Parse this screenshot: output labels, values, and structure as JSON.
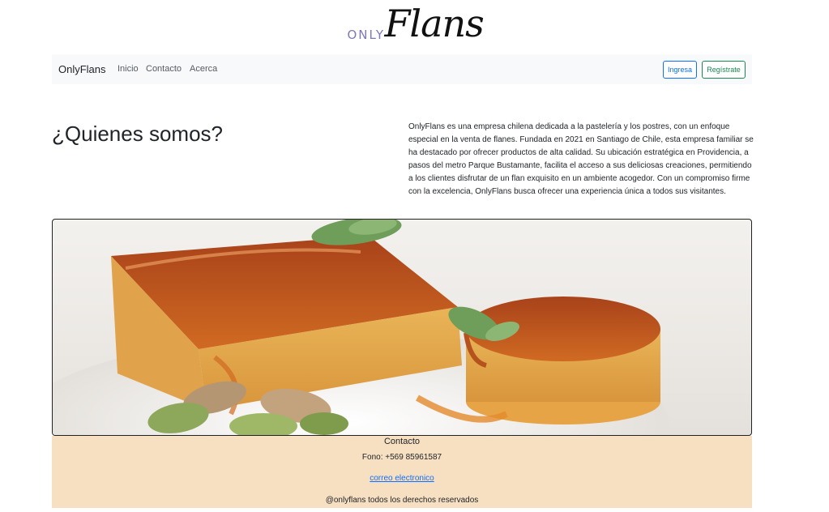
{
  "logo": {
    "prefix": "ONLY",
    "main": "Flans"
  },
  "navbar": {
    "brand": "OnlyFlans",
    "links": [
      "Inicio",
      "Contacto",
      "Acerca"
    ],
    "login_label": "Ingresa",
    "register_label": "Regístrate"
  },
  "about": {
    "title": "¿Quienes somos?",
    "text": "OnlyFlans es una empresa chilena dedicada a la pastelería y los postres, con un enfoque especial en la venta de flanes. Fundada en 2021 en Santiago de Chile, esta empresa familiar se ha destacado por ofrecer productos de alta calidad. Su ubicación estratégica en Providencia, a pasos del metro Parque Bustamante, facilita el acceso a sus deliciosas creaciones, permitiendo a los clientes disfrutar de un flan exquisito en un ambiente acogedor. Con un compromiso firme con la excelencia, OnlyFlans busca ofrecer una experiencia única a todos sus visitantes."
  },
  "footer": {
    "title": "Contacto",
    "phone": "Fono: +569 85961587",
    "email_link": "correo electronico",
    "copyright": "@onlyflans todos los derechos reservados"
  },
  "colors": {
    "navbar_bg": "#f8f9fa",
    "footer_bg": "#f7e0c2",
    "login_accent": "#0d6efd",
    "register_accent": "#198754",
    "logo_prefix": "#7d7ab8"
  }
}
